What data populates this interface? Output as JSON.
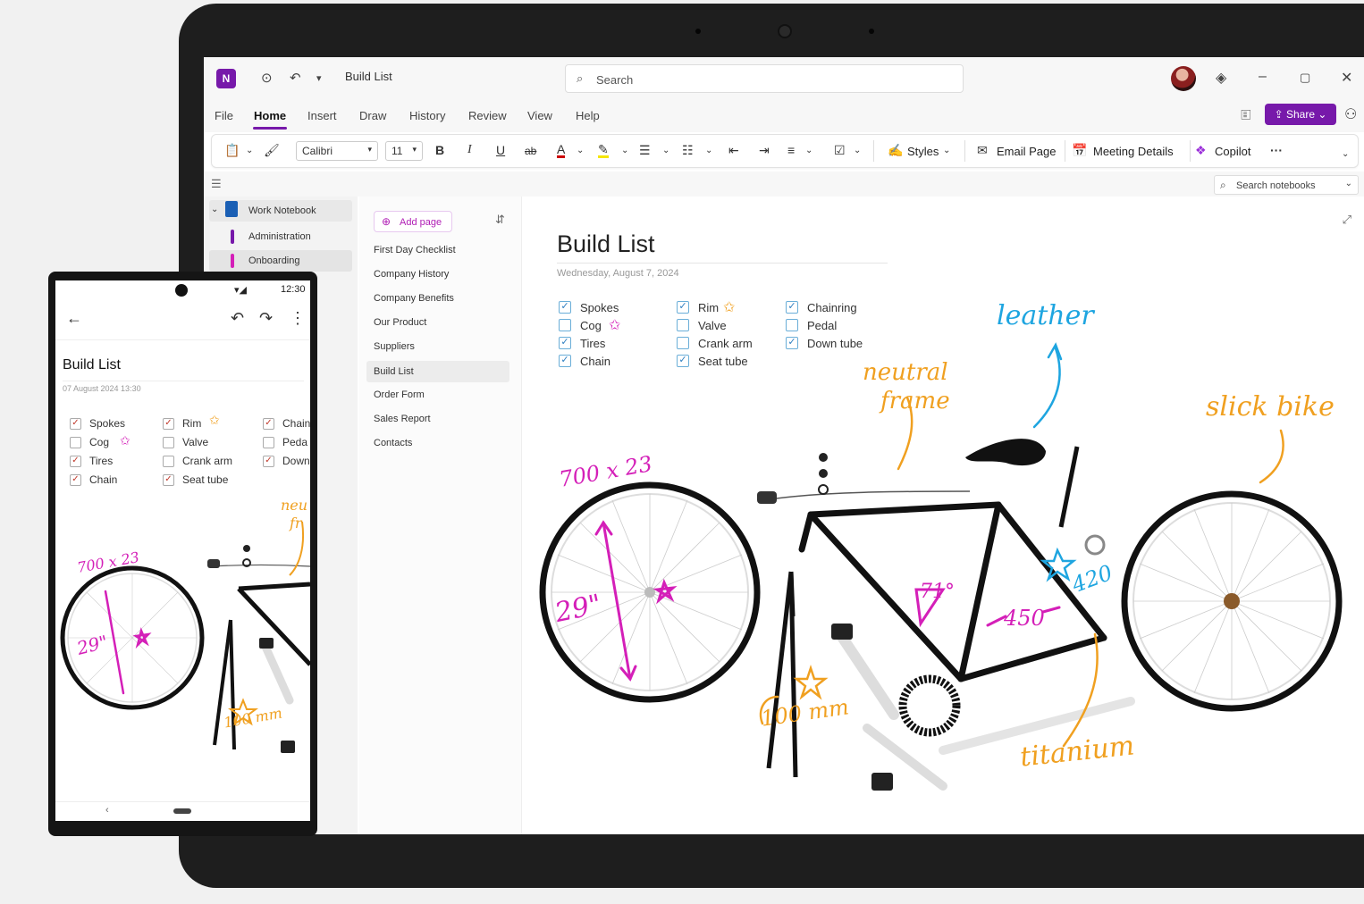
{
  "app": {
    "logo": "N",
    "title": "Build List",
    "search_placeholder": "Search",
    "window_icons": [
      "gem-icon",
      "minimize-icon",
      "maximize-icon",
      "close-icon"
    ]
  },
  "menu": {
    "items": [
      "File",
      "Home",
      "Insert",
      "Draw",
      "History",
      "Review",
      "View",
      "Help"
    ],
    "active": "Home",
    "share_label": "Share"
  },
  "ribbon": {
    "font_name": "Calibri",
    "font_size": "11",
    "styles_label": "Styles",
    "email_label": "Email Page",
    "meeting_label": "Meeting Details",
    "copilot_label": "Copilot",
    "more_label": "···"
  },
  "notebook": {
    "name": "Work Notebook",
    "sections": [
      "Administration",
      "Onboarding"
    ],
    "search_label": "Search notebooks"
  },
  "pages": {
    "add_label": "Add page",
    "items": [
      "First Day Checklist",
      "Company History",
      "Company Benefits",
      "Our Product",
      "Suppliers",
      "Build List",
      "Order Form",
      "Sales Report",
      "Contacts"
    ],
    "selected": "Build List"
  },
  "note": {
    "title": "Build List",
    "date": "Wednesday, August 7, 2024",
    "todos": [
      {
        "label": "Spokes",
        "checked": true
      },
      {
        "label": "Cog",
        "checked": false
      },
      {
        "label": "Tires",
        "checked": true
      },
      {
        "label": "Chain",
        "checked": true
      },
      {
        "label": "Rim",
        "checked": true
      },
      {
        "label": "Valve",
        "checked": false
      },
      {
        "label": "Crank arm",
        "checked": false
      },
      {
        "label": "Seat tube",
        "checked": true
      },
      {
        "label": "Chainring",
        "checked": true
      },
      {
        "label": "Pedal",
        "checked": false
      },
      {
        "label": "Down tube",
        "checked": true
      }
    ],
    "annotations": {
      "leather": "leather",
      "neutral_frame_1": "neutral",
      "neutral_frame_2": "frame",
      "slick_bike": "slick bike",
      "wheel_size": "700 x 23",
      "diameter": "29\"",
      "angle": "71°",
      "length_450": "450",
      "length_420": "420",
      "crank": "100 mm",
      "titanium": "titanium"
    },
    "colors": {
      "magenta": "#d41fb8",
      "orange": "#f0a020",
      "blue": "#1ea5e0"
    }
  },
  "phone": {
    "time": "12:30",
    "title": "Build List",
    "date": "07 August 2024      13:30",
    "todos": [
      {
        "label": "Spokes",
        "checked": true
      },
      {
        "label": "Cog",
        "checked": false
      },
      {
        "label": "Tires",
        "checked": true
      },
      {
        "label": "Chain",
        "checked": true
      },
      {
        "label": "Rim",
        "checked": true
      },
      {
        "label": "Valve",
        "checked": false
      },
      {
        "label": "Crank arm",
        "checked": false
      },
      {
        "label": "Seat tube",
        "checked": true
      },
      {
        "label": "Chain",
        "checked": true
      },
      {
        "label": "Peda",
        "checked": false
      },
      {
        "label": "Down",
        "checked": true
      }
    ],
    "annotations": {
      "wheel_size": "700 x 23",
      "diameter": "29\"",
      "crank": "100 mm",
      "neutral_1": "neu",
      "neutral_2": "fr"
    }
  }
}
